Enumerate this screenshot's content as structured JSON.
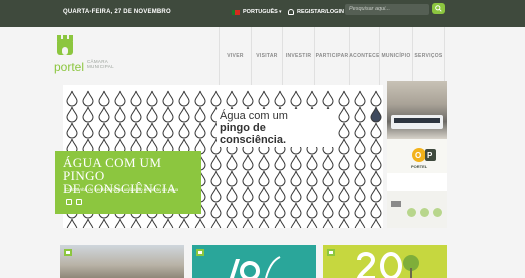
{
  "topbar": {
    "date": "QUARTA-FEIRA, 27 DE NOVEMBRO",
    "language": "PORTUGUÊS",
    "login": "REGISTAR/LOGIN",
    "search_placeholder": "Pesquisar aqui..."
  },
  "logo": {
    "word": "portel",
    "sub1": "CÂMARA",
    "sub2": "MUNICIPAL"
  },
  "nav": [
    {
      "label": "VIVER"
    },
    {
      "label": "VISITAR"
    },
    {
      "label": "INVESTIR"
    },
    {
      "label": "PARTICIPAR"
    },
    {
      "label": "ACONTECE"
    },
    {
      "label": "MUNICÍPIO"
    },
    {
      "label": "SERVIÇOS"
    }
  ],
  "hero": {
    "line1": "Água com um",
    "line2": "pingo de consciência.",
    "title_line1": "ÁGUA COM UM PINGO",
    "title_line2": "DE CONSCIÊNCIA",
    "subtitle": "Campanha de sensibilização utilização eficiente da água"
  },
  "side": {
    "op_label": "PORTEL"
  },
  "colors": {
    "accent": "#8cc63f",
    "topbar": "#3f4a3d",
    "card_teal": "#2aa69a",
    "card_green": "#c6d73f"
  },
  "icons": [
    "search-icon",
    "user-icon",
    "flag-icon",
    "prev-icon",
    "next-icon",
    "card-tag-icon"
  ]
}
